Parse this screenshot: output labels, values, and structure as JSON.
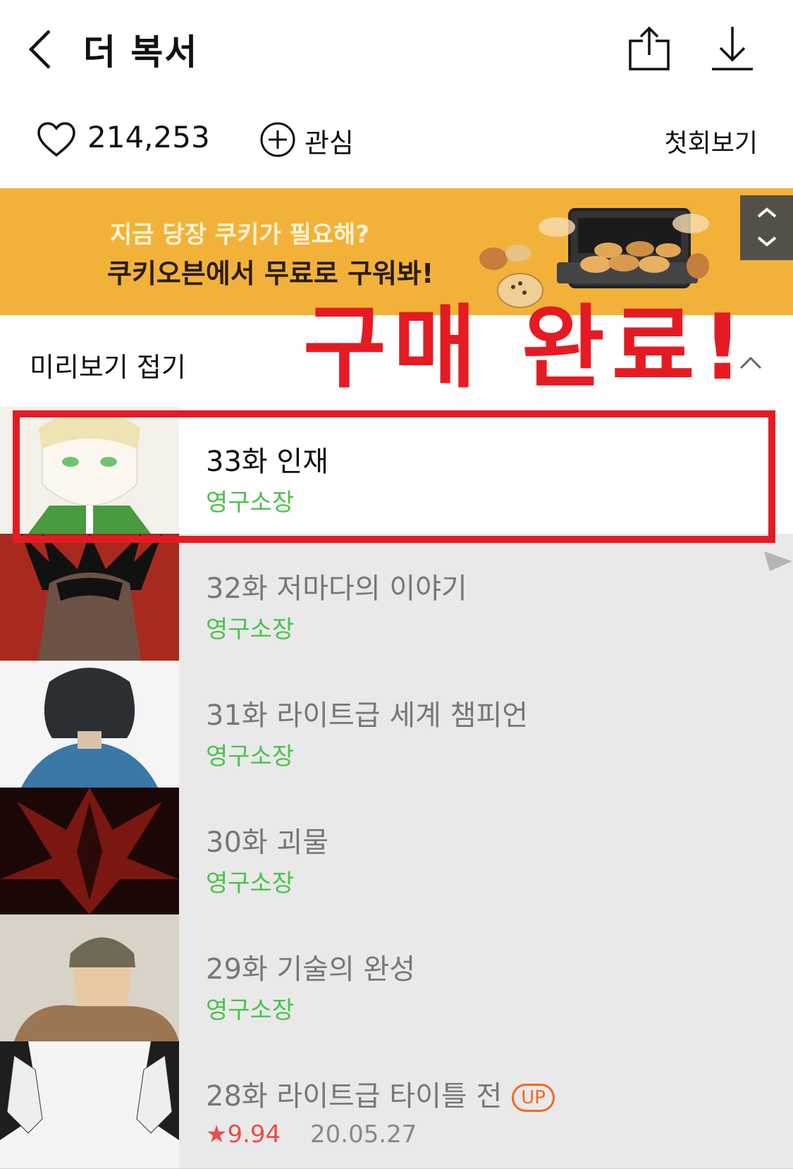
{
  "header": {
    "back_icon": "chevron-left-icon",
    "title": "더 복서",
    "share_icon": "share-icon",
    "download_icon": "download-icon"
  },
  "info": {
    "likes": "214,253",
    "favorite_label": "관심",
    "first_episode_label": "첫회보기"
  },
  "banner": {
    "line1": "지금 당장 쿠키가 필요해?",
    "line2": "쿠키오븐에서 무료로 구워봐!",
    "background": "#f2b23a"
  },
  "preview": {
    "label": "미리보기 접기",
    "collapse_icon": "chevron-up-icon"
  },
  "overlay": {
    "text": "구매 완료!",
    "color": "#e51b24"
  },
  "episodes": [
    {
      "title": "33화 인재",
      "status": "영구소장"
    },
    {
      "title": "32화 저마다의 이야기",
      "status": "영구소장"
    },
    {
      "title": "31화 라이트급 세계 챔피언",
      "status": "영구소장"
    },
    {
      "title": "30화 괴물",
      "status": "영구소장"
    },
    {
      "title": "29화 기술의 완성",
      "status": "영구소장"
    },
    {
      "title": "28화 라이트급 타이틀 전",
      "badge": "UP",
      "rating": "★9.94",
      "date": "20.05.27"
    }
  ]
}
